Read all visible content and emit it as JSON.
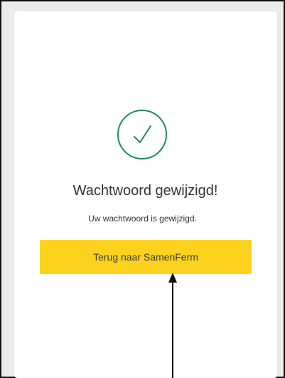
{
  "window": {
    "frame_color": "#111111"
  },
  "success_card": {
    "icon": "checkmark-circle-icon",
    "icon_color": "#1f8a5b",
    "title": "Wachtwoord gewijzigd!",
    "message": "Uw wachtwoord is gewijzigd.",
    "button_label": "Terug naar SamenFerm",
    "button_color": "#fdd21f"
  },
  "annotation": {
    "arrow_target": "Terug naar SamenFerm"
  }
}
